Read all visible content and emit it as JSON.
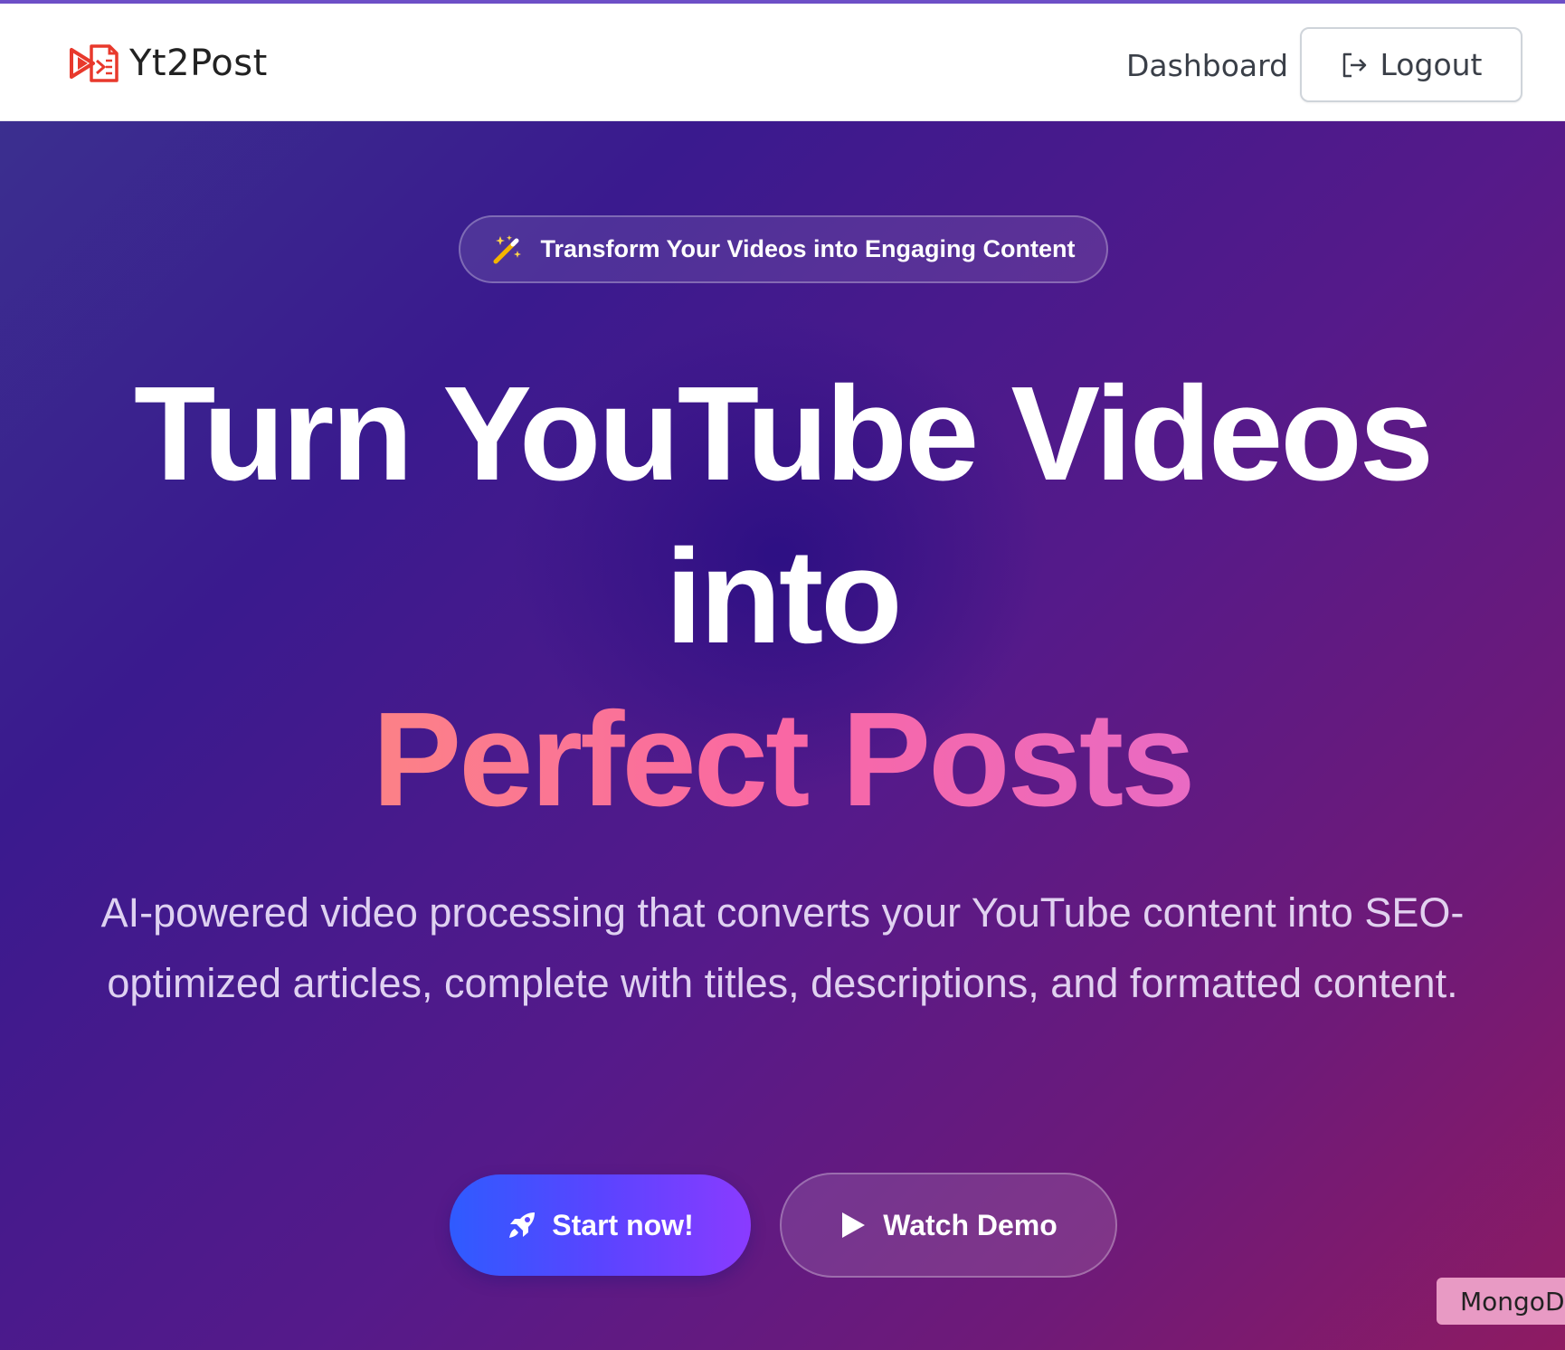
{
  "navbar": {
    "brand_name": "Yt2Post",
    "dashboard_label": "Dashboard",
    "logout_label": "Logout"
  },
  "hero": {
    "tag_text": "Transform Your Videos into Engaging Content",
    "headline_line1": "Turn YouTube Videos",
    "headline_line2": "into",
    "headline_line3": "Perfect Posts",
    "subtitle": "AI-powered video processing that converts your YouTube content into SEO-optimized articles, complete with titles, descriptions, and formatted content.",
    "start_button_label": "Start now!",
    "demo_button_label": "Watch Demo"
  },
  "badge": {
    "text": "MongoDB"
  },
  "colors": {
    "accent_bar": "#6d4fc7",
    "logo_red": "#e8392c",
    "highlight_start": "#ff9a6b",
    "highlight_end": "#da6ee0",
    "start_button_start": "#2f5bff",
    "start_button_end": "#8a3bff",
    "badge_bg": "#e89ac4"
  },
  "icons": {
    "brand": "video-to-document-icon",
    "logout": "logout-icon",
    "tag": "magic-wand-icon",
    "start": "rocket-icon",
    "demo": "play-icon"
  }
}
